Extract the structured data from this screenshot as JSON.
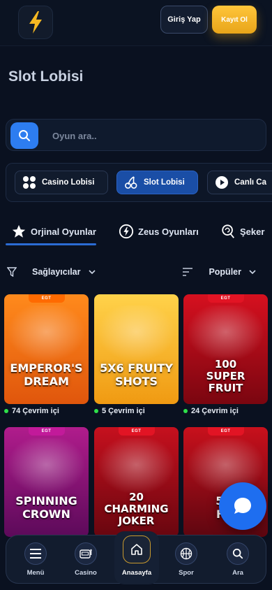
{
  "header": {
    "logo_icon": "lightning-bolt-icon",
    "login_label": "Giriş Yap",
    "register_label": "Kayıt Ol"
  },
  "page": {
    "title": "Slot Lobisi"
  },
  "search": {
    "placeholder": "Oyun ara.."
  },
  "lobby_tabs": [
    {
      "label": "Casino Lobisi",
      "icon": "grid-icon",
      "active": false
    },
    {
      "label": "Slot Lobisi",
      "icon": "cherries-icon",
      "active": true
    },
    {
      "label": "Canlı Ca",
      "icon": "play-icon",
      "active": false
    }
  ],
  "category_tabs": [
    {
      "label": "Orjinal Oyunlar",
      "icon": "star-icon",
      "active": true
    },
    {
      "label": "Zeus Oyunları",
      "icon": "lightning-circle-icon",
      "active": false
    },
    {
      "label": "Şeker",
      "icon": "lollipop-icon",
      "active": false
    }
  ],
  "filters": {
    "providers_label": "Sağlayıcılar",
    "sort_label": "Popüler"
  },
  "games": [
    {
      "provider": "EGT",
      "title": "EMPEROR'S\nDREAM",
      "online": "74 Çevrim içi",
      "colors": {
        "bg": "#ff8a1c",
        "bg2": "#e0560c",
        "badge": "#ff6a00"
      }
    },
    {
      "provider": "",
      "title": "5X6 FRUITY\nSHOTS",
      "online": "5 Çevrim içi",
      "colors": {
        "bg": "#ffd24a",
        "bg2": "#f09a12",
        "badge": "#ffb020"
      }
    },
    {
      "provider": "EGT",
      "title": "100\nSUPER\nFRUIT",
      "online": "24 Çevrim içi",
      "colors": {
        "bg": "#d6101f",
        "bg2": "#7a0610",
        "badge": "#e21424"
      }
    },
    {
      "provider": "EGT",
      "title": "SPINNING\nCROWN",
      "online": "",
      "colors": {
        "bg": "#b01c8c",
        "bg2": "#5c0a5a",
        "badge": "#c21a9a"
      }
    },
    {
      "provider": "EGT",
      "title": "20\nCHARMING\nJOKER",
      "online": "",
      "colors": {
        "bg": "#c6101e",
        "bg2": "#68060f",
        "badge": "#e21424"
      }
    },
    {
      "provider": "EGT",
      "title": "5 C\nHO",
      "online": "",
      "colors": {
        "bg": "#c8101c",
        "bg2": "#5e0610",
        "badge": "#e21424"
      }
    }
  ],
  "bottom_nav": [
    {
      "label": "Menü",
      "icon": "menu-icon"
    },
    {
      "label": "Casino",
      "icon": "slot-machine-icon"
    },
    {
      "label": "Anasayfa",
      "icon": "home-icon",
      "active": true
    },
    {
      "label": "Spor",
      "icon": "basketball-icon"
    },
    {
      "label": "Ara",
      "icon": "search-icon"
    }
  ],
  "chat": {
    "icon": "chat-bubble-icon"
  }
}
